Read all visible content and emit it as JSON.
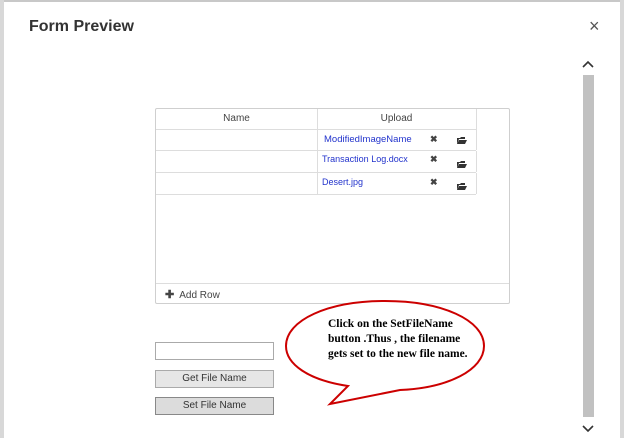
{
  "modal": {
    "title": "Form Preview",
    "close_glyph": "×"
  },
  "scrollbar": {
    "up_glyph": "^",
    "down_glyph": "v"
  },
  "grid": {
    "columns": [
      "Name",
      "Upload"
    ],
    "rows": [
      {
        "name": "",
        "file": "ModifiedImageName"
      },
      {
        "name": "",
        "file": "Transaction Log.docx"
      },
      {
        "name": "",
        "file": "Desert.jpg"
      }
    ],
    "add_row_label": "Add Row"
  },
  "controls": {
    "filename_input_value": "",
    "get_button_label": "Get File Name",
    "set_button_label": "Set File Name"
  },
  "callout": {
    "text": "Click on the SetFileName button .Thus , the filename gets set to the new file name."
  },
  "colors": {
    "link": "#2233cc",
    "callout_border": "#cc0000",
    "scroll_thumb": "#c1c1c1"
  }
}
